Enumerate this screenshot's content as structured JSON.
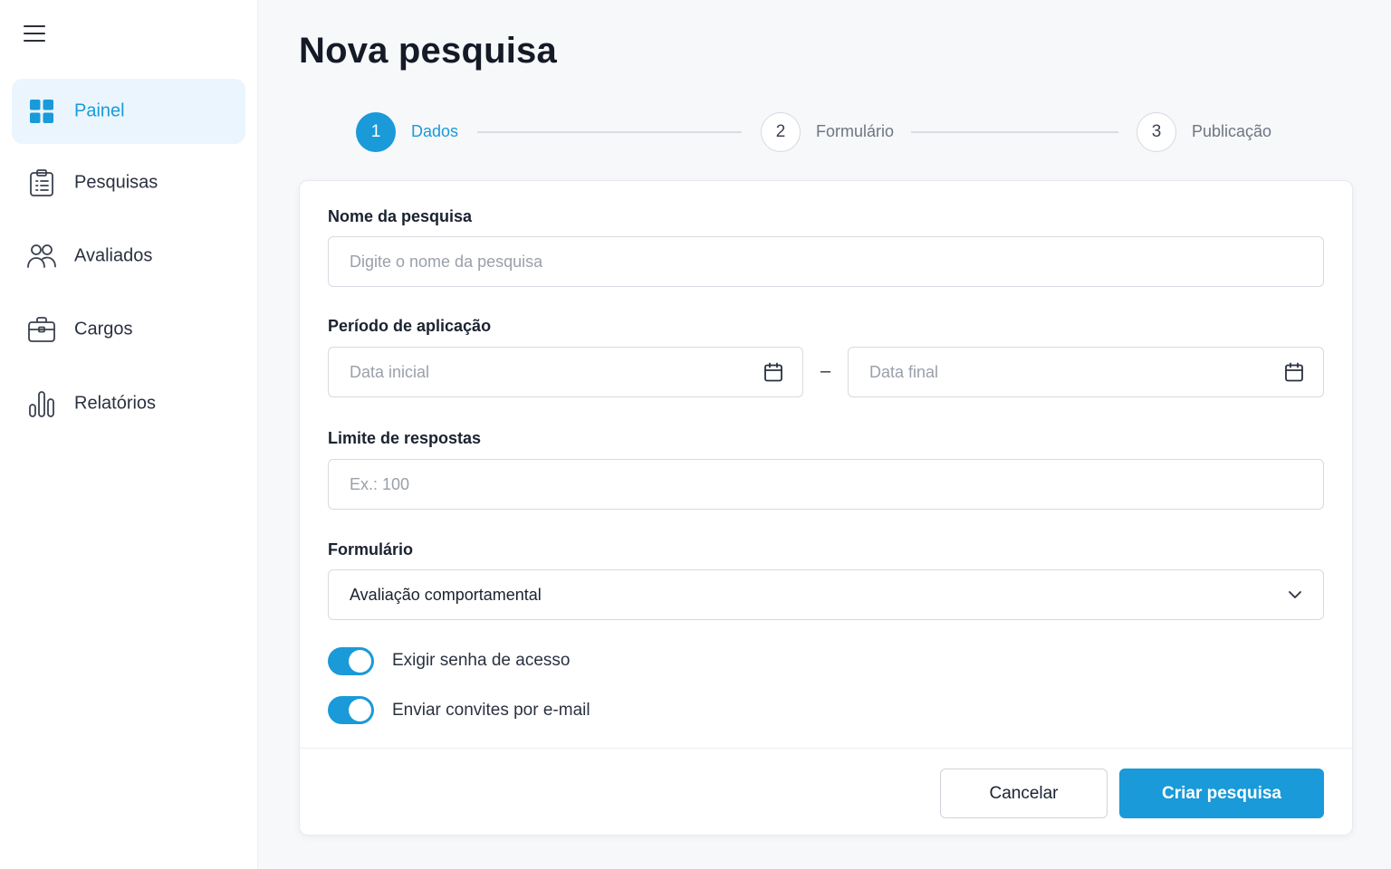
{
  "sidebar": {
    "items": [
      {
        "label": "Painel",
        "icon": "grid-icon",
        "active": true
      },
      {
        "label": "Pesquisas",
        "icon": "clipboard-icon"
      },
      {
        "label": "Avaliados",
        "icon": "users-icon"
      },
      {
        "label": "Cargos",
        "icon": "briefcase-icon"
      },
      {
        "label": "Relatórios",
        "icon": "bar-chart-icon"
      }
    ]
  },
  "page": {
    "title": "Nova pesquisa"
  },
  "stepper": {
    "steps": [
      {
        "number": "1",
        "label": "Dados",
        "active": true
      },
      {
        "number": "2",
        "label": "Formulário"
      },
      {
        "number": "3",
        "label": "Publicação"
      }
    ]
  },
  "form": {
    "name": {
      "label": "Nome da pesquisa",
      "placeholder": "Digite o nome da pesquisa"
    },
    "period": {
      "label": "Período de aplicação",
      "start_placeholder": "Data inicial",
      "end_placeholder": "Data final",
      "separator": "–"
    },
    "limit": {
      "label": "Limite de respostas",
      "placeholder": "Ex.: 100"
    },
    "form_select": {
      "label": "Formulário",
      "value": "Avaliação comportamental"
    },
    "toggles": [
      {
        "label": "Exigir senha de acesso",
        "on": true
      },
      {
        "label": "Enviar convites por e-mail",
        "on": true
      }
    ]
  },
  "actions": {
    "cancel": "Cancelar",
    "submit": "Criar pesquisa"
  },
  "colors": {
    "accent": "#1a9ad8",
    "active_bg": "#eaf5fd"
  }
}
